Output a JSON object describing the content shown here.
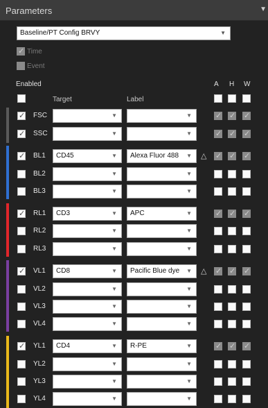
{
  "header": {
    "title": "Parameters",
    "collapse_icon": "triangle-down"
  },
  "config": {
    "selected": "Baseline/PT Config BRVY"
  },
  "options": {
    "time_label": "Time",
    "time_checked": true,
    "event_label": "Event",
    "event_checked": false
  },
  "columns": {
    "enabled": "Enabled",
    "target": "Target",
    "label": "Label",
    "a": "A",
    "h": "H",
    "w": "W"
  },
  "header_checks": {
    "enabled": false,
    "a": false,
    "h": false,
    "w": false
  },
  "colors": {
    "scatter": "#5a5a5a",
    "blue": "#2f6fd0",
    "red": "#e1262b",
    "violet": "#7a3fa0",
    "yellow": "#e9b81a"
  },
  "rows": [
    {
      "channel": "FSC",
      "enabled": true,
      "target": "",
      "label": "",
      "warn": false,
      "a": true,
      "h": true,
      "w": true
    },
    {
      "channel": "SSC",
      "enabled": true,
      "target": "",
      "label": "",
      "warn": false,
      "a": true,
      "h": true,
      "w": true
    },
    {
      "channel": "BL1",
      "enabled": true,
      "target": "CD45",
      "label": "Alexa Fluor 488",
      "warn": true,
      "a": true,
      "h": true,
      "w": true
    },
    {
      "channel": "BL2",
      "enabled": false,
      "target": "",
      "label": "",
      "warn": false,
      "a": false,
      "h": false,
      "w": false
    },
    {
      "channel": "BL3",
      "enabled": false,
      "target": "",
      "label": "",
      "warn": false,
      "a": false,
      "h": false,
      "w": false
    },
    {
      "channel": "RL1",
      "enabled": true,
      "target": "CD3",
      "label": "APC",
      "warn": false,
      "a": true,
      "h": true,
      "w": true
    },
    {
      "channel": "RL2",
      "enabled": false,
      "target": "",
      "label": "",
      "warn": false,
      "a": false,
      "h": false,
      "w": false
    },
    {
      "channel": "RL3",
      "enabled": false,
      "target": "",
      "label": "",
      "warn": false,
      "a": false,
      "h": false,
      "w": false
    },
    {
      "channel": "VL1",
      "enabled": true,
      "target": "CD8",
      "label": "Pacific Blue dye",
      "warn": true,
      "a": true,
      "h": true,
      "w": true
    },
    {
      "channel": "VL2",
      "enabled": false,
      "target": "",
      "label": "",
      "warn": false,
      "a": false,
      "h": false,
      "w": false
    },
    {
      "channel": "VL3",
      "enabled": false,
      "target": "",
      "label": "",
      "warn": false,
      "a": false,
      "h": false,
      "w": false
    },
    {
      "channel": "VL4",
      "enabled": false,
      "target": "",
      "label": "",
      "warn": false,
      "a": false,
      "h": false,
      "w": false
    },
    {
      "channel": "YL1",
      "enabled": true,
      "target": "CD4",
      "label": "R-PE",
      "warn": false,
      "a": true,
      "h": true,
      "w": true
    },
    {
      "channel": "YL2",
      "enabled": false,
      "target": "",
      "label": "",
      "warn": false,
      "a": false,
      "h": false,
      "w": false
    },
    {
      "channel": "YL3",
      "enabled": false,
      "target": "",
      "label": "",
      "warn": false,
      "a": false,
      "h": false,
      "w": false
    },
    {
      "channel": "YL4",
      "enabled": false,
      "target": "",
      "label": "",
      "warn": false,
      "a": false,
      "h": false,
      "w": false
    }
  ]
}
